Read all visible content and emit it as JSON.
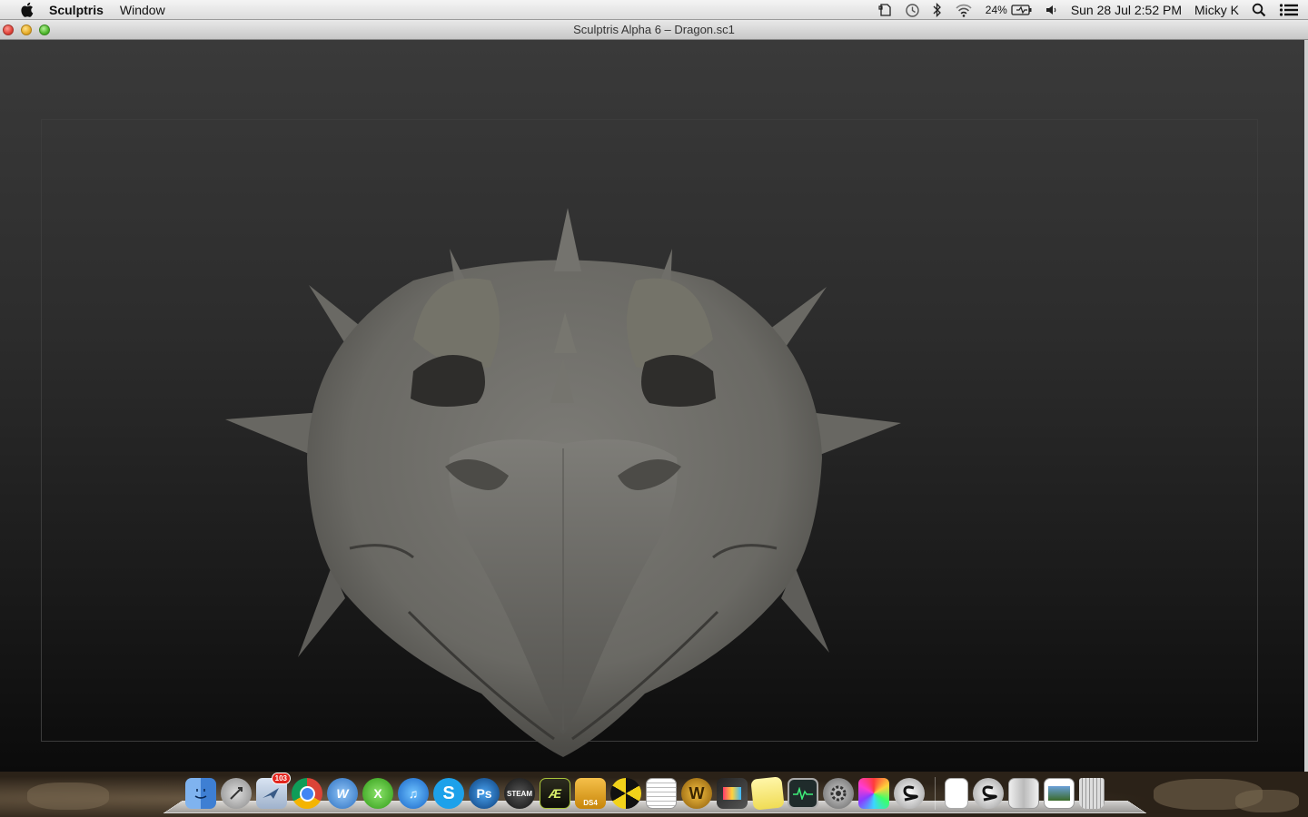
{
  "menubar": {
    "app_name": "Sculptris",
    "menus": [
      "Window"
    ],
    "battery": "24%",
    "datetime": "Sun 28 Jul  2:52 PM",
    "user": "Micky K",
    "status_icons": [
      "evernote-icon",
      "time-machine-icon",
      "bluetooth-icon",
      "wifi-icon",
      "battery-icon",
      "volume-icon",
      "spotlight-icon",
      "notification-center-icon"
    ]
  },
  "window": {
    "title": "Sculptris Alpha 6 – Dragon.sc1"
  },
  "dock": {
    "items": [
      {
        "name": "finder",
        "badge": ""
      },
      {
        "name": "launchpad",
        "badge": ""
      },
      {
        "name": "mail",
        "badge": "103"
      },
      {
        "name": "chrome",
        "badge": ""
      },
      {
        "name": "word",
        "badge": ""
      },
      {
        "name": "xbox",
        "badge": ""
      },
      {
        "name": "itunes",
        "badge": ""
      },
      {
        "name": "skype",
        "badge": ""
      },
      {
        "name": "photoshop",
        "badge": ""
      },
      {
        "name": "steam",
        "badge": ""
      },
      {
        "name": "after-effects",
        "badge": ""
      },
      {
        "name": "ds4",
        "badge": ""
      },
      {
        "name": "radiation",
        "badge": ""
      },
      {
        "name": "textedit",
        "badge": ""
      },
      {
        "name": "world-of-warcraft",
        "badge": ""
      },
      {
        "name": "final-cut",
        "badge": ""
      },
      {
        "name": "stickies",
        "badge": ""
      },
      {
        "name": "activity-monitor",
        "badge": ""
      },
      {
        "name": "system-preferences",
        "badge": ""
      },
      {
        "name": "colors",
        "badge": ""
      },
      {
        "name": "sculptris",
        "badge": ""
      },
      {
        "name": "document",
        "badge": ""
      },
      {
        "name": "sculptris-2",
        "badge": ""
      },
      {
        "name": "downloads-stack",
        "badge": ""
      },
      {
        "name": "photos-stack",
        "badge": ""
      },
      {
        "name": "trash",
        "badge": ""
      }
    ]
  },
  "colors": {
    "viewport_top": "#3a3a3a",
    "viewport_bottom": "#0b0b0b",
    "model_clay": "#6f6e6a"
  }
}
